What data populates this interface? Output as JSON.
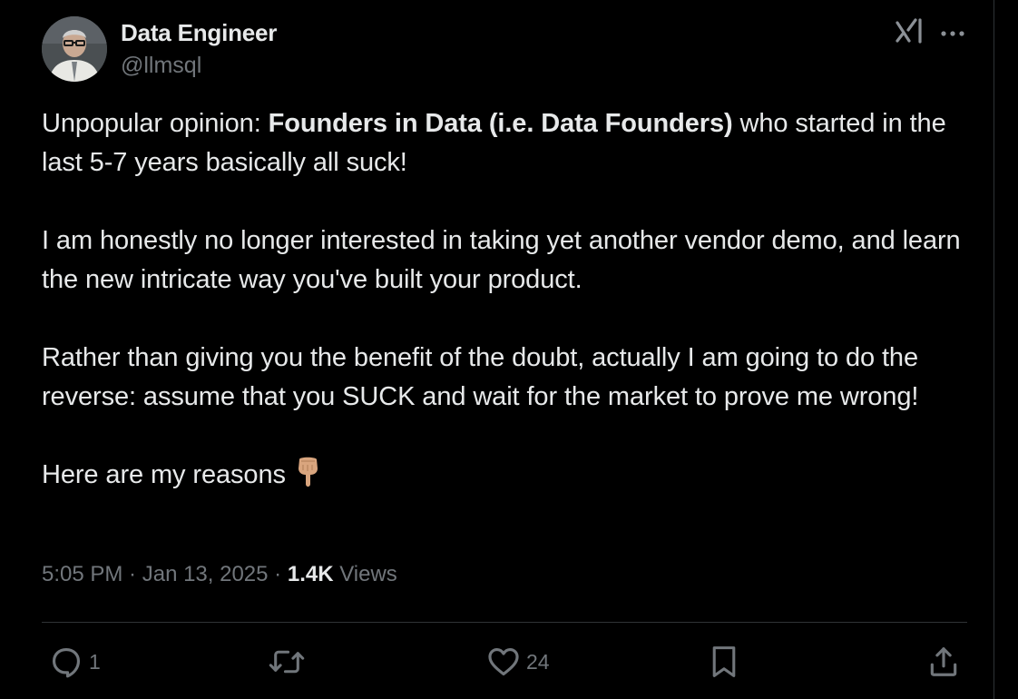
{
  "author": {
    "display_name": "Data Engineer",
    "handle": "@llmsql",
    "avatar_icon": "person-avatar"
  },
  "header_actions": {
    "grok_icon": "grok-icon",
    "more_icon": "more-options-icon"
  },
  "tweet": {
    "p1_prefix": "Unpopular opinion: ",
    "p1_bold": "Founders in Data (i.e. Data Founders)",
    "p1_suffix": " who started in the last 5-7 years basically all suck!",
    "p2": "I am honestly no longer interested in taking yet another vendor demo, and learn the new intricate way you've built your product.",
    "p3": "Rather than giving you the benefit of the doubt, actually I am going to do the reverse: assume that you SUCK and wait for the market to prove me wrong!",
    "p4": "Here are my reasons",
    "p4_emoji": "pointing-down-hand"
  },
  "meta": {
    "time": "5:05 PM",
    "sep1": " · ",
    "date": "Jan 13, 2025",
    "sep2": " · ",
    "views_count": "1.4K",
    "views_label": " Views"
  },
  "actions": {
    "reply_count": "1",
    "repost_count": "",
    "like_count": "24",
    "bookmark_count": "",
    "share_count": ""
  },
  "colors": {
    "background": "#000000",
    "text_primary": "#e7e9ea",
    "text_secondary": "#71767b",
    "divider": "#2f3336"
  }
}
